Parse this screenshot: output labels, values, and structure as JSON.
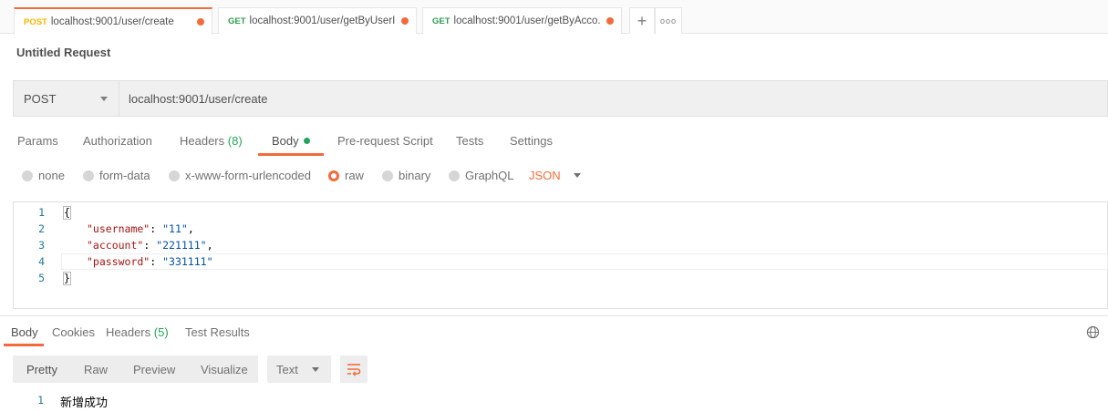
{
  "tabs": [
    {
      "method": "POST",
      "url": "localhost:9001/user/create"
    },
    {
      "method": "GET",
      "url": "localhost:9001/user/getByUserI..."
    },
    {
      "method": "GET",
      "url": "localhost:9001/user/getByAcco..."
    }
  ],
  "more_tabs_glyph": "ooo",
  "request_title": "Untitled Request",
  "request": {
    "method": "POST",
    "url": "localhost:9001/user/create"
  },
  "request_tabs": {
    "params": "Params",
    "authorization": "Authorization",
    "headers": "Headers",
    "headers_count": "(8)",
    "body": "Body",
    "pre_request": "Pre-request Script",
    "tests": "Tests",
    "settings": "Settings"
  },
  "body_modes": {
    "none": "none",
    "form_data": "form-data",
    "urlencoded": "x-www-form-urlencoded",
    "raw": "raw",
    "binary": "binary",
    "graphql": "GraphQL",
    "selected": "raw",
    "format": "JSON"
  },
  "editor": {
    "line_numbers": [
      "1",
      "2",
      "3",
      "4",
      "5"
    ],
    "open_brace": "{",
    "close_brace": "}",
    "fields": [
      {
        "key": "\"username\"",
        "value": "\"11\"",
        "sep": ": ",
        "trail": ","
      },
      {
        "key": "\"account\"",
        "value": "\"221111\"",
        "sep": ": ",
        "trail": ","
      },
      {
        "key": "\"password\"",
        "value": "\"331111\"",
        "sep": ": ",
        "trail": ""
      }
    ]
  },
  "response_tabs": {
    "body": "Body",
    "cookies": "Cookies",
    "headers": "Headers",
    "headers_count": "(5)",
    "test_results": "Test Results"
  },
  "response_view": {
    "pretty": "Pretty",
    "raw": "Raw",
    "preview": "Preview",
    "visualize": "Visualize",
    "format": "Text"
  },
  "response_body": {
    "line_number": "1",
    "text": "新增成功"
  },
  "colors": {
    "accent": "#f26b3a",
    "post": "#ffb400",
    "get": "#2f9c4e",
    "count": "#26a35a"
  }
}
